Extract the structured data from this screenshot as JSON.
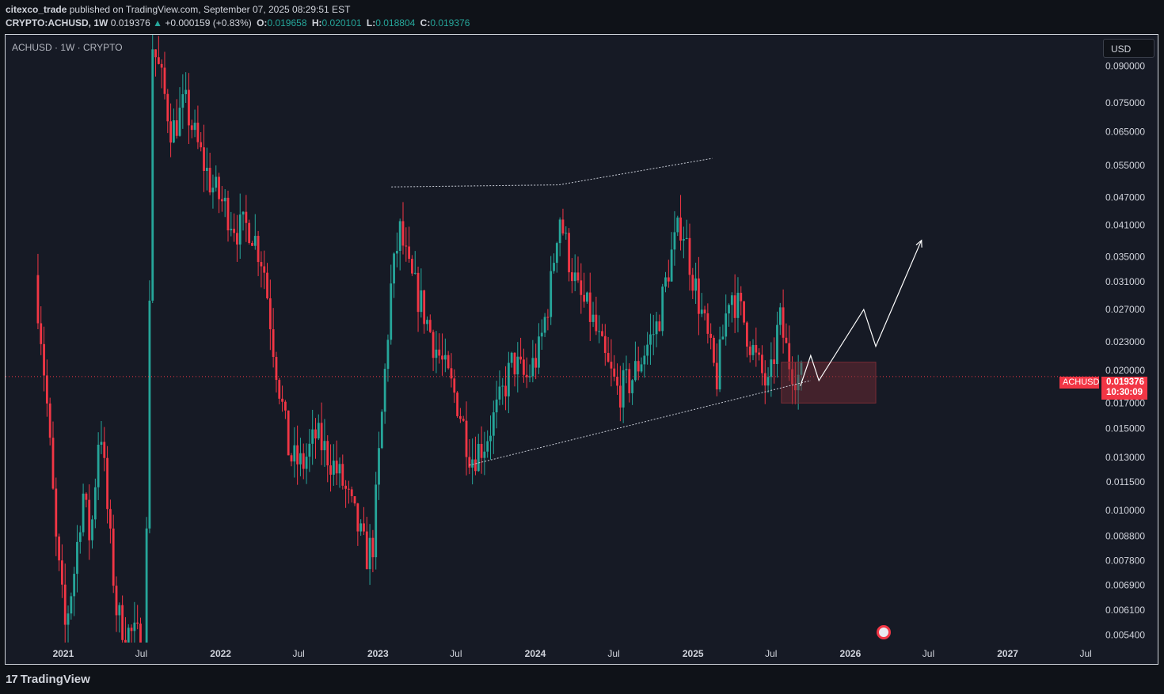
{
  "header": {
    "author": "citexco_trade",
    "published_text": "published on TradingView.com, September 07, 2025 08:29:51 EST",
    "symbol_full": "CRYPTO:ACHUSD, 1W",
    "last": "0.019376",
    "change": "+0.000159 (+0.83%)",
    "o_label": "O:",
    "o_value": "0.019658",
    "h_label": "H:",
    "h_value": "0.020101",
    "l_label": "L:",
    "l_value": "0.018804",
    "c_label": "C:",
    "c_value": "0.019376"
  },
  "chart_label": "ACHUSD · 1W · CRYPTO",
  "currency_button": "USD",
  "price_tag": {
    "symbol": "ACHUSD",
    "price": "0.019376",
    "countdown": "10:30:09"
  },
  "logo_text": "TradingView",
  "colors": {
    "up": "#26a69a",
    "down": "#f23645",
    "background": "#161a25",
    "drawing": "#d1d4dc",
    "zone": "#7a2c35"
  },
  "chart_data": {
    "type": "candlestick",
    "title": "ACHUSD · 1W · CRYPTO",
    "y_scale": "log",
    "y_tick_labels": [
      "0.090000",
      "0.075000",
      "0.065000",
      "0.055000",
      "0.047000",
      "0.041000",
      "0.035000",
      "0.031000",
      "0.027000",
      "0.023000",
      "0.020000",
      "0.017000",
      "0.015000",
      "0.013000",
      "0.011500",
      "0.010000",
      "0.008800",
      "0.007800",
      "0.006900",
      "0.006100",
      "0.005400"
    ],
    "x_tick_labels": [
      "2021",
      "Jul",
      "2022",
      "Jul",
      "2023",
      "Jul",
      "2024",
      "Jul",
      "2025",
      "Jul",
      "2026",
      "Jul",
      "2027",
      "Jul"
    ],
    "x_tick_dates": [
      "2021-01-01",
      "2021-07-01",
      "2022-01-01",
      "2022-07-01",
      "2023-01-01",
      "2023-07-01",
      "2024-01-01",
      "2024-07-01",
      "2025-01-01",
      "2025-07-01",
      "2026-01-01",
      "2026-07-01",
      "2027-01-01",
      "2027-07-01"
    ],
    "ylim": [
      0.0052,
      0.105
    ],
    "xlim": [
      "2020-08-20",
      "2027-08-01"
    ],
    "last_price": 0.019376,
    "price_path": [
      [
        "2020-11-01",
        0.032
      ],
      [
        "2020-11-15",
        0.024
      ],
      [
        "2020-12-01",
        0.016
      ],
      [
        "2020-12-20",
        0.0085
      ],
      [
        "2021-01-10",
        0.0056
      ],
      [
        "2021-02-01",
        0.0075
      ],
      [
        "2021-02-20",
        0.011
      ],
      [
        "2021-03-10",
        0.0085
      ],
      [
        "2021-04-01",
        0.016
      ],
      [
        "2021-04-20",
        0.0095
      ],
      [
        "2021-05-10",
        0.006
      ],
      [
        "2021-06-01",
        0.0055
      ],
      [
        "2021-07-15",
        0.0052
      ],
      [
        "2021-08-01",
        0.1
      ],
      [
        "2021-08-20",
        0.085
      ],
      [
        "2021-09-15",
        0.065
      ],
      [
        "2021-10-15",
        0.075
      ],
      [
        "2021-11-15",
        0.06
      ],
      [
        "2021-12-15",
        0.05
      ],
      [
        "2022-01-15",
        0.045
      ],
      [
        "2022-02-15",
        0.04
      ],
      [
        "2022-03-15",
        0.041
      ],
      [
        "2022-04-15",
        0.034
      ],
      [
        "2022-05-10",
        0.022
      ],
      [
        "2022-06-15",
        0.013
      ],
      [
        "2022-07-15",
        0.0125
      ],
      [
        "2022-08-15",
        0.0145
      ],
      [
        "2022-09-15",
        0.013
      ],
      [
        "2022-10-15",
        0.0115
      ],
      [
        "2022-11-15",
        0.0095
      ],
      [
        "2022-12-10",
        0.008
      ],
      [
        "2022-12-25",
        0.0085
      ],
      [
        "2023-01-15",
        0.016
      ],
      [
        "2023-02-05",
        0.03
      ],
      [
        "2023-02-25",
        0.04
      ],
      [
        "2023-03-20",
        0.032
      ],
      [
        "2023-04-15",
        0.028
      ],
      [
        "2023-05-15",
        0.023
      ],
      [
        "2023-06-10",
        0.02
      ],
      [
        "2023-07-10",
        0.017
      ],
      [
        "2023-08-10",
        0.013
      ],
      [
        "2023-09-10",
        0.014
      ],
      [
        "2023-10-15",
        0.017
      ],
      [
        "2023-11-15",
        0.021
      ],
      [
        "2023-12-15",
        0.019
      ],
      [
        "2024-01-15",
        0.022
      ],
      [
        "2024-02-10",
        0.03
      ],
      [
        "2024-03-01",
        0.044
      ],
      [
        "2024-03-20",
        0.036
      ],
      [
        "2024-04-15",
        0.029
      ],
      [
        "2024-05-15",
        0.026
      ],
      [
        "2024-06-15",
        0.021
      ],
      [
        "2024-07-15",
        0.018
      ],
      [
        "2024-08-15",
        0.019
      ],
      [
        "2024-09-15",
        0.022
      ],
      [
        "2024-10-15",
        0.025
      ],
      [
        "2024-11-15",
        0.035
      ],
      [
        "2024-12-10",
        0.042
      ],
      [
        "2025-01-05",
        0.032
      ],
      [
        "2025-02-01",
        0.025
      ],
      [
        "2025-03-01",
        0.019
      ],
      [
        "2025-04-01",
        0.03
      ],
      [
        "2025-05-01",
        0.026
      ],
      [
        "2025-06-01",
        0.021
      ],
      [
        "2025-07-01",
        0.018
      ],
      [
        "2025-07-25",
        0.026
      ],
      [
        "2025-08-15",
        0.021
      ],
      [
        "2025-09-07",
        0.019376
      ]
    ],
    "annotations": {
      "upper_trendline": [
        [
          "2023-02-01",
          0.0495
        ],
        [
          "2024-02-25",
          0.05
        ],
        [
          "2025-02-15",
          0.057
        ]
      ],
      "lower_trendline": [
        [
          "2023-08-01",
          0.0125
        ],
        [
          "2025-10-01",
          0.019
        ]
      ],
      "projection": [
        [
          "2025-09-07",
          0.0185
        ],
        [
          "2025-10-01",
          0.0215
        ],
        [
          "2025-10-20",
          0.019
        ],
        [
          "2026-02-01",
          0.027
        ],
        [
          "2026-03-01",
          0.0225
        ],
        [
          "2026-06-15",
          0.038
        ]
      ],
      "zone": {
        "from": "2025-07-25",
        "to": "2026-03-01",
        "top": 0.0208,
        "bottom": 0.017
      }
    }
  }
}
